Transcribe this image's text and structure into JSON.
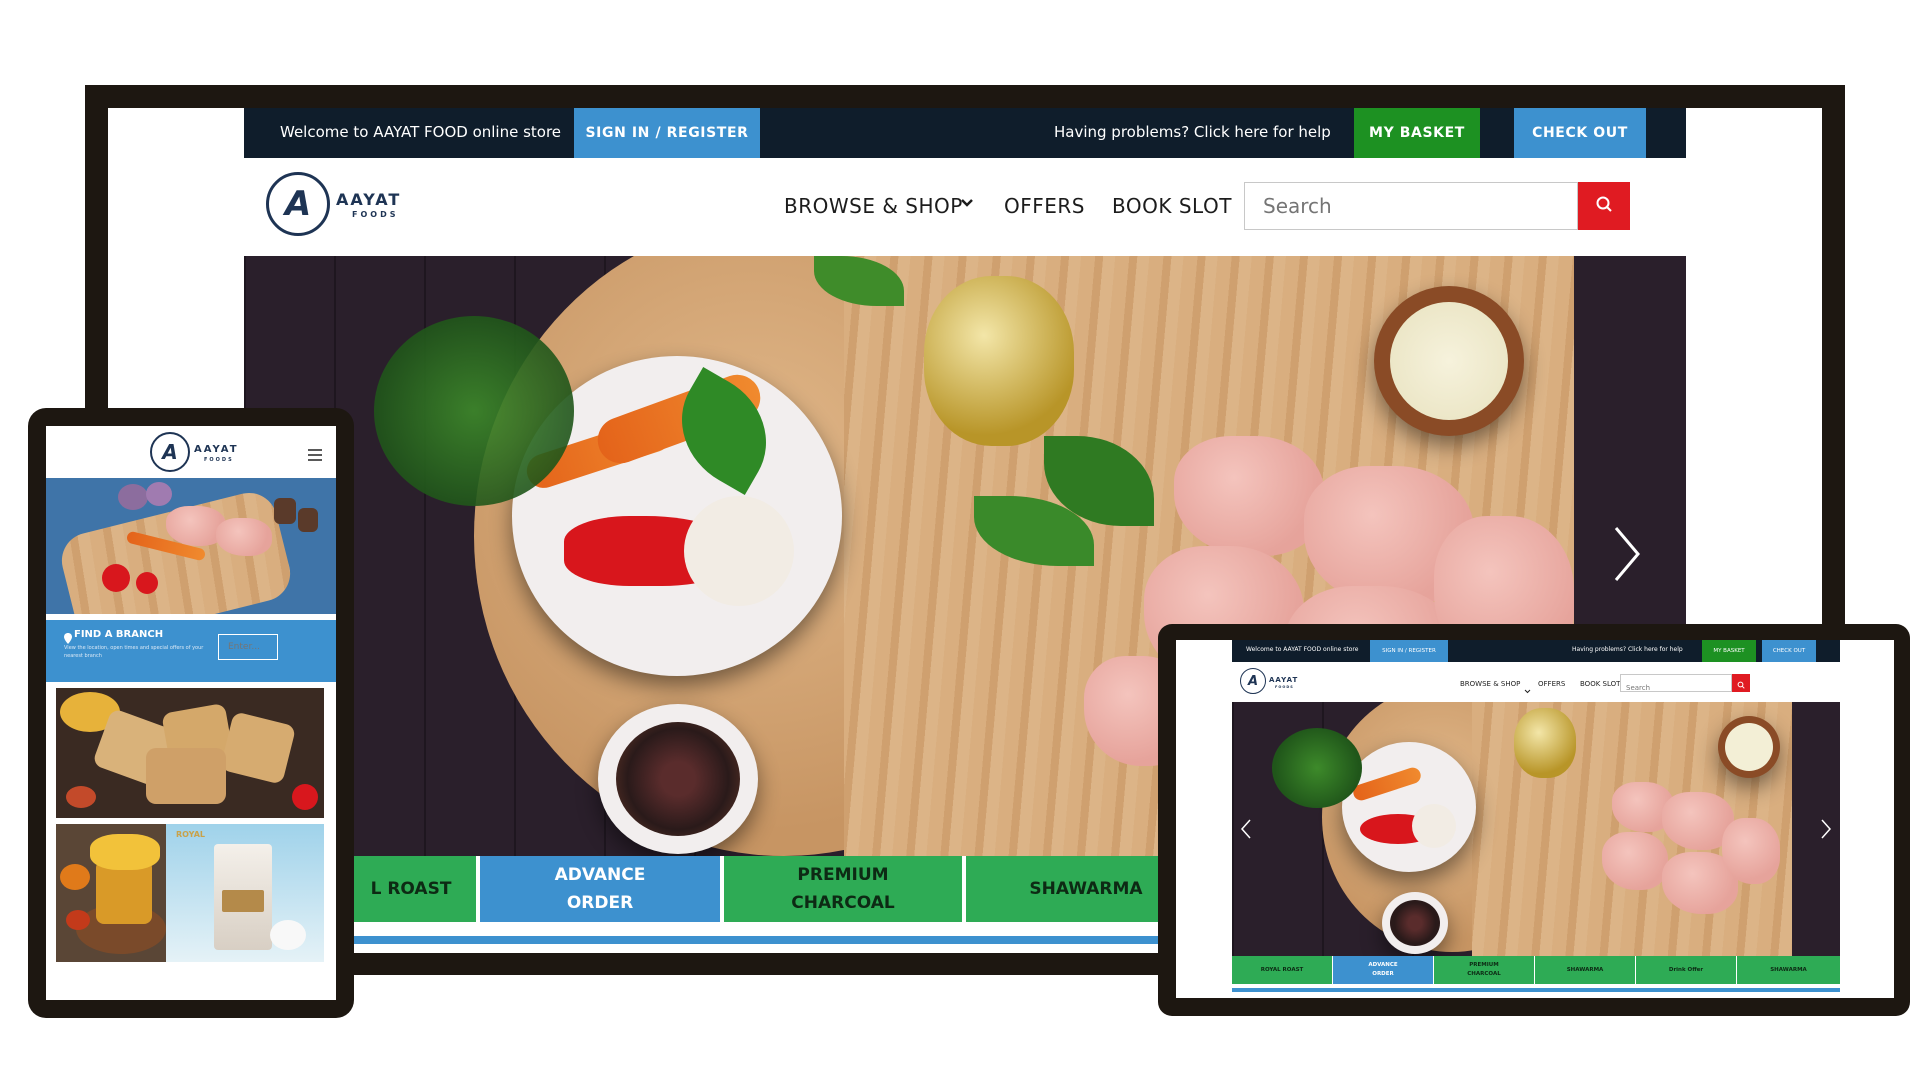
{
  "colors": {
    "frame": "#1d1711",
    "topbar_bg": "#0f1d2b",
    "signin_blue": "#3d91cf",
    "basket_green": "#1d9122",
    "checkout_blue": "#3d91cf",
    "search_red": "#e01b22",
    "category_green": "#2eab55",
    "category_blue": "#3d91cf",
    "logo_navy": "#1e3454"
  },
  "desktop": {
    "topbar": {
      "welcome": "Welcome to AAYAT FOOD online store",
      "signin": "SIGN IN / REGISTER",
      "help": "Having problems? Click here for help",
      "basket": "MY BASKET",
      "checkout": "CHECK OUT"
    },
    "logo": {
      "mark": "A",
      "name": "AAYAT",
      "sub": "FOODS"
    },
    "nav": {
      "browse": "BROWSE & SHOP",
      "offers": "OFFERS",
      "book": "BOOK SLOT"
    },
    "search": {
      "placeholder": "Search"
    },
    "icons": {
      "chevron": "chevron-down-icon",
      "search": "search-icon",
      "next": "chevron-right-icon"
    },
    "categories": [
      "L ROAST",
      "ADVANCE ORDER",
      "PREMIUM CHARCOAL",
      "SHAWARMA"
    ]
  },
  "phone": {
    "logo": {
      "mark": "A",
      "name": "AAYAT",
      "sub": "FOODS"
    },
    "menu_icon": "hamburger-icon",
    "find_branch": {
      "title": "FIND A BRANCH",
      "description": "View the location, open times and special offers of your nearest branch",
      "input_placeholder": "Enter..."
    },
    "product_label": "ROYAL"
  },
  "laptop": {
    "topbar": {
      "welcome": "Welcome to AAYAT FOOD online store",
      "signin": "SIGN IN / REGISTER",
      "help": "Having problems? Click here for help",
      "basket": "MY BASKET",
      "checkout": "CHECK OUT"
    },
    "logo": {
      "mark": "A",
      "name": "AAYAT",
      "sub": "FOODS"
    },
    "nav": {
      "browse": "BROWSE & SHOP",
      "offers": "OFFERS",
      "book": "BOOK SLOT"
    },
    "search": {
      "placeholder": "Search"
    },
    "categories": [
      "ROYAL ROAST",
      "ADVANCE ORDER",
      "PREMIUM CHARCOAL",
      "SHAWARMA",
      "Drink Offer",
      "SHAWARMA"
    ]
  }
}
